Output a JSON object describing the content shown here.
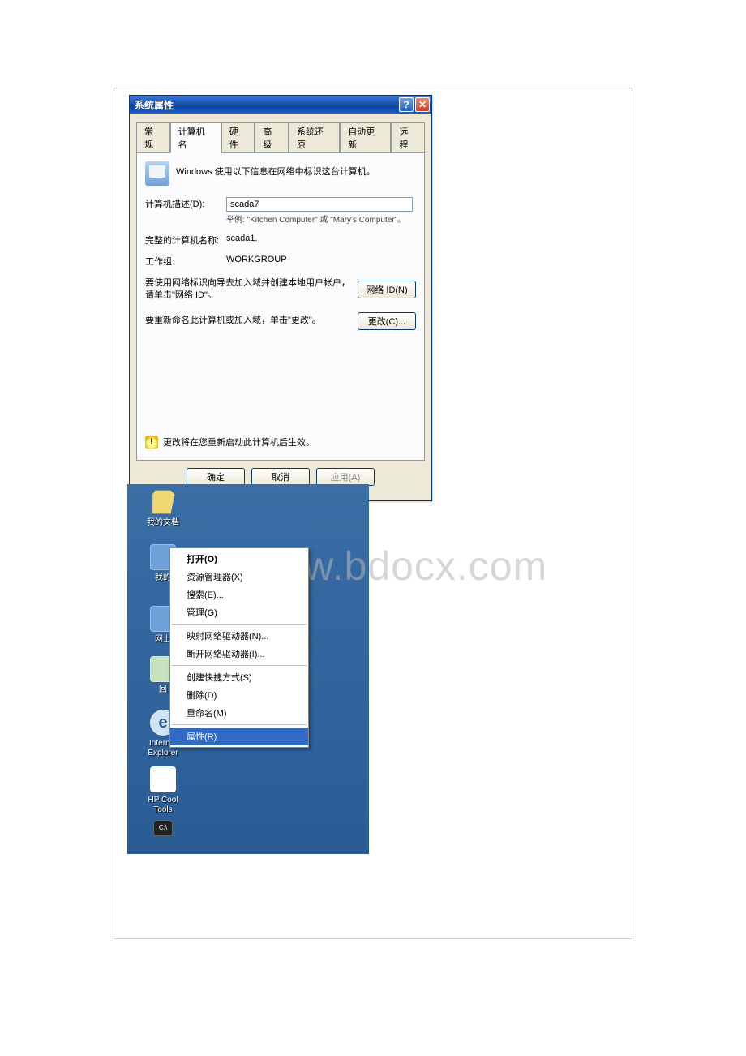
{
  "watermark": "www.bdocx.com",
  "dialog": {
    "title": "系统属性",
    "tabs": [
      "常规",
      "计算机名",
      "硬件",
      "高级",
      "系统还原",
      "自动更新",
      "远程"
    ],
    "active_tab_index": 1,
    "info_text": "Windows 使用以下信息在网络中标识这台计算机。",
    "rows": {
      "desc_label": "计算机描述(D):",
      "desc_value": "scada7",
      "desc_hint": "举例: \"Kitchen Computer\" 或 \"Mary's Computer\"。",
      "fullname_label": "完整的计算机名称:",
      "fullname_value": "scada1.",
      "workgroup_label": "工作组:",
      "workgroup_value": "WORKGROUP"
    },
    "section_netid": {
      "desc": "要使用网络标识向导去加入域并创建本地用户帐户，请单击\"网络 ID\"。",
      "button": "网络 ID(N)"
    },
    "section_change": {
      "desc": "要重新命名此计算机或加入域，单击\"更改\"。",
      "button": "更改(C)..."
    },
    "warning": "更改将在您重新启动此计算机后生效。",
    "buttons": {
      "ok": "确定",
      "cancel": "取消",
      "apply": "应用(A)"
    }
  },
  "desktop": {
    "icons": {
      "docs": "我的文档",
      "mycomputer": "我的",
      "network": "网上",
      "recycle": "回",
      "ie_line1": "Internet",
      "ie_line2": "Explorer",
      "hp_line1": "HP Cool",
      "hp_line2": "Tools",
      "cmd": ""
    },
    "context_menu": {
      "open": "打开(O)",
      "explorer": "资源管理器(X)",
      "search": "搜索(E)...",
      "manage": "管理(G)",
      "map_drive": "映射网络驱动器(N)...",
      "disconnect": "断开网络驱动器(I)...",
      "shortcut": "创建快捷方式(S)",
      "delete": "删除(D)",
      "rename": "重命名(M)",
      "properties": "属性(R)"
    }
  }
}
